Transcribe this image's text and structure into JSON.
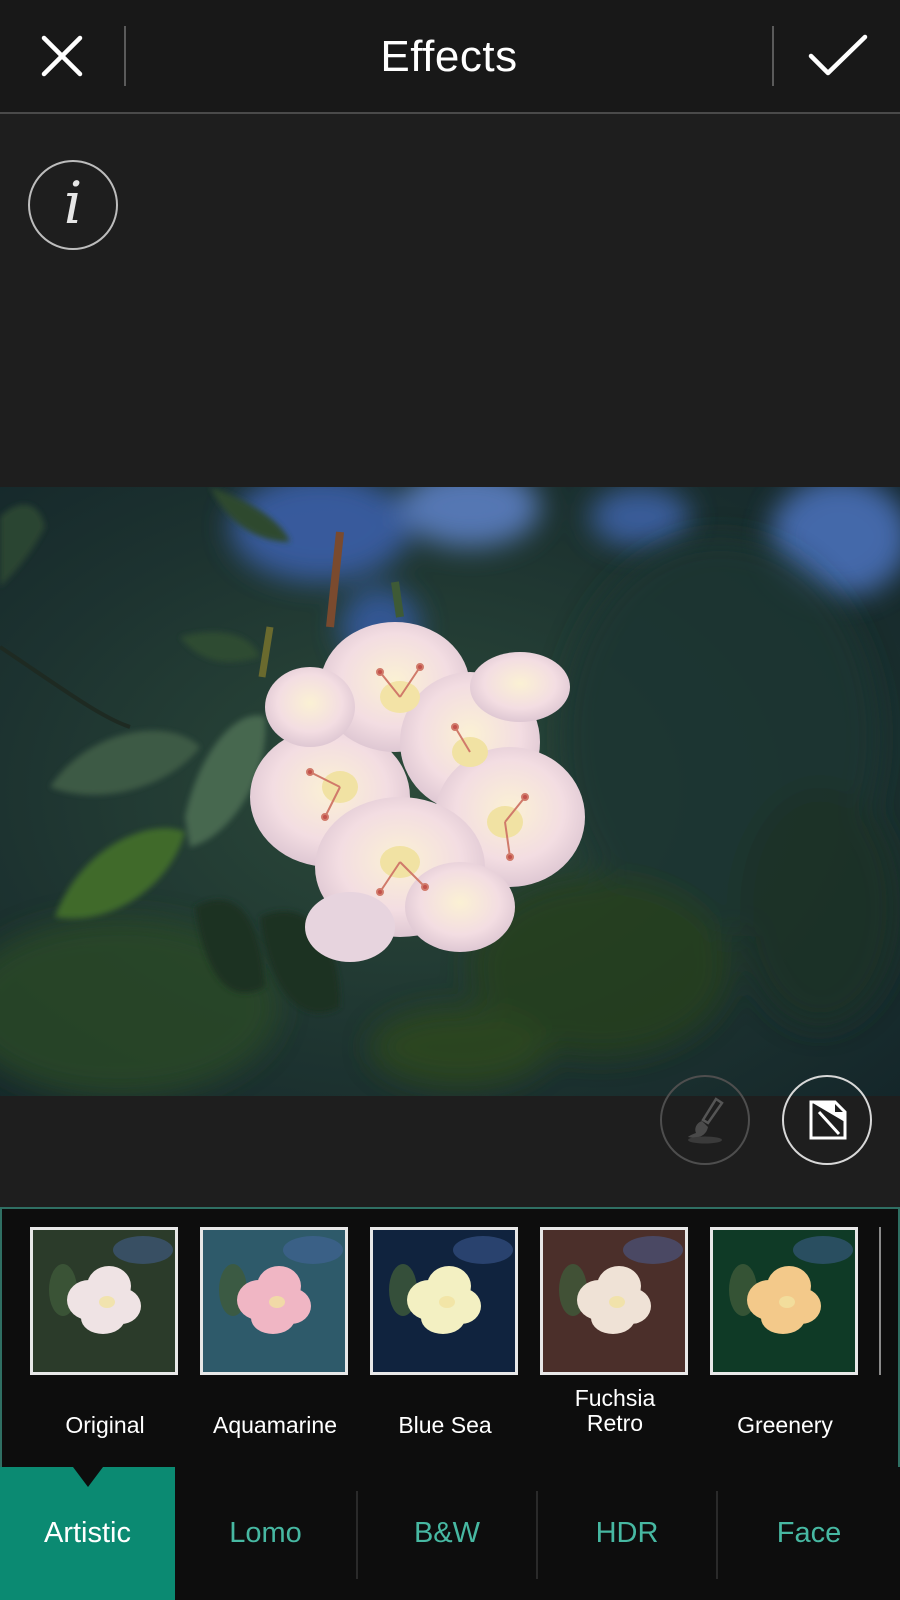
{
  "header": {
    "title": "Effects",
    "close_icon": "close-icon",
    "apply_icon": "checkmark-icon"
  },
  "canvas": {
    "info_icon": "info-icon",
    "info_glyph": "i",
    "brush_icon": "brush-icon",
    "compare_icon": "compare-icon"
  },
  "effects": [
    {
      "label": "Original",
      "tint": "#2b3b2a",
      "selected": false
    },
    {
      "label": "Aquamarine",
      "tint": "#2e5a6a",
      "selected": false
    },
    {
      "label": "Blue Sea",
      "tint": "#10233e",
      "selected": false
    },
    {
      "label": "Fuchsia\nRetro",
      "tint": "#4b2f2a",
      "selected": false
    },
    {
      "label": "Greenery",
      "tint": "#0f3a26",
      "selected": false
    }
  ],
  "tabs": [
    {
      "label": "Artistic",
      "active": true
    },
    {
      "label": "Lomo",
      "active": false
    },
    {
      "label": "B&W",
      "active": false
    },
    {
      "label": "HDR",
      "active": false
    },
    {
      "label": "Face",
      "active": false
    }
  ],
  "colors": {
    "accent": "#0b8a72",
    "accent_text": "#47b8a2",
    "background": "#1e1e1e"
  }
}
